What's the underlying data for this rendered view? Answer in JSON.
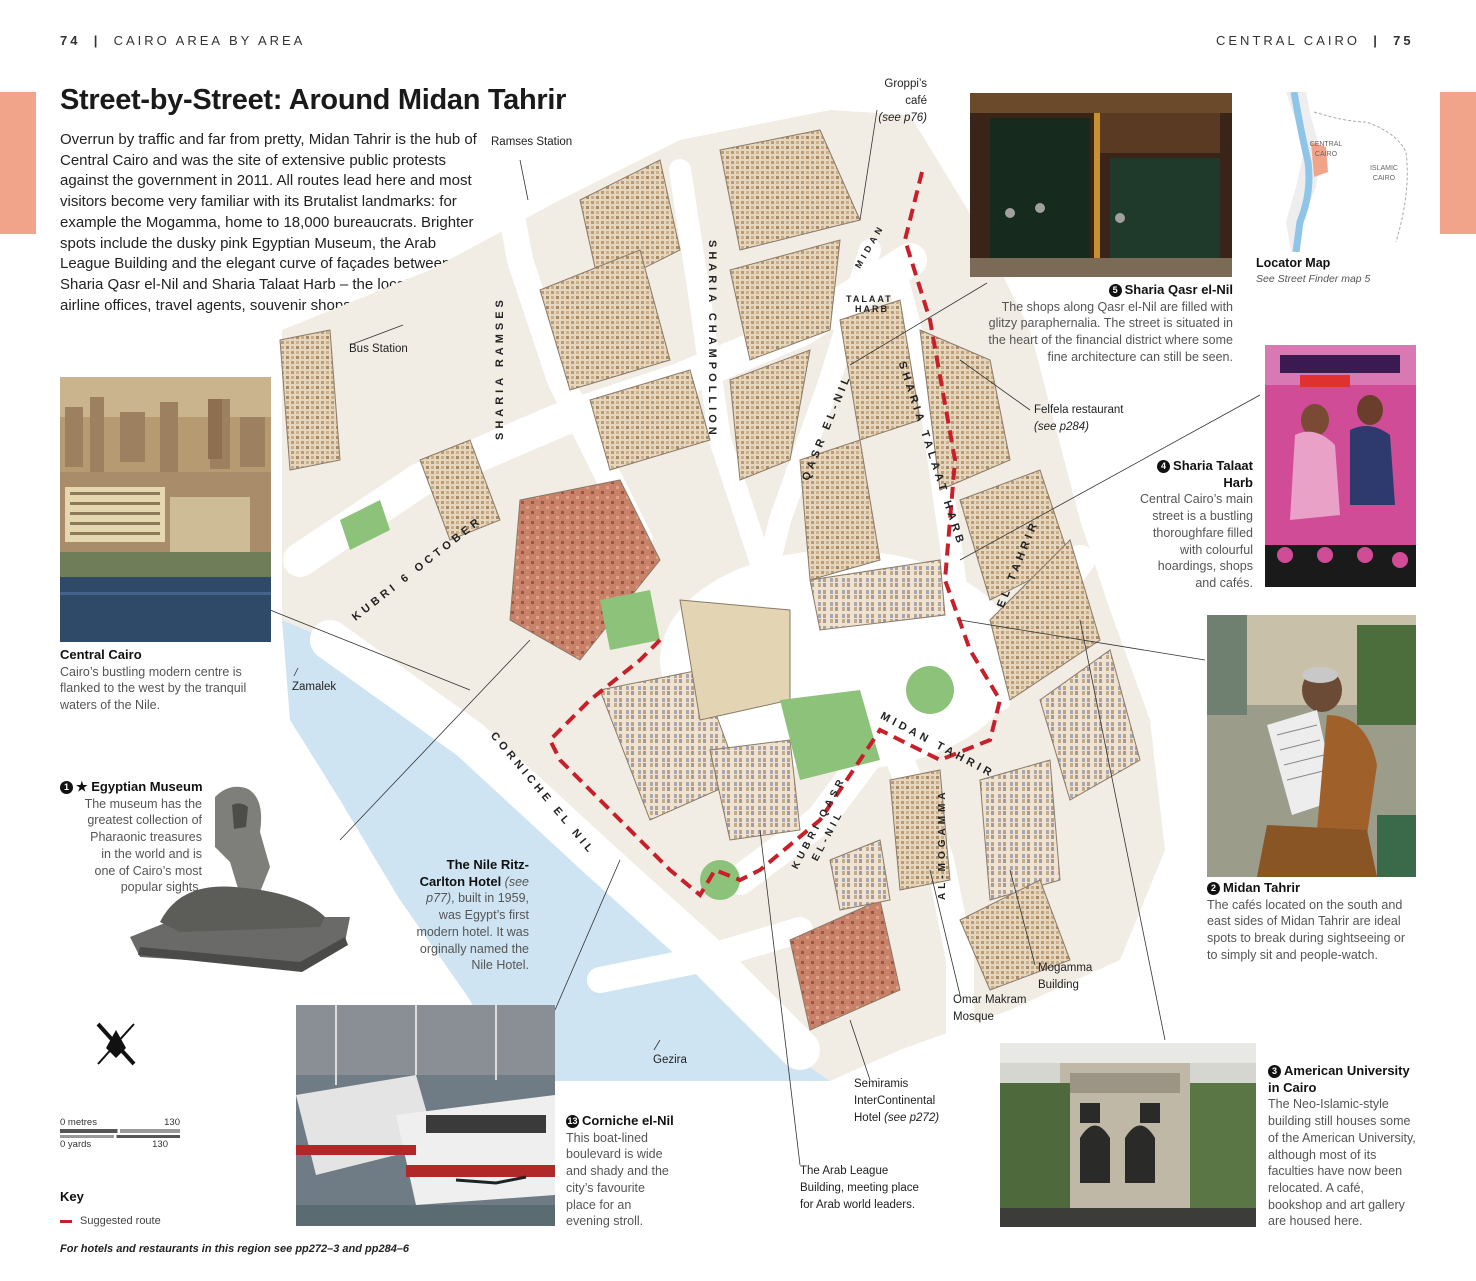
{
  "header": {
    "left_page": "74",
    "left_section": "CAIRO AREA BY AREA",
    "right_section": "CENTRAL CAIRO",
    "right_page": "75",
    "divider": "|"
  },
  "title": "Street-by-Street: Around Midan Tahrir",
  "intro": "Overrun by traffic and far from pretty, Midan Tahrir is the hub of Central Cairo and was the site of extensive public protests against the government in 2011. All routes lead here and most visitors become very familiar with its Brutalist landmarks: for example the Mogamma, home to 18,000 bureaucrats. Brighter spots include the dusky pink Egyptian Museum, the Arab League Building and the elegant curve of façades between Sharia Qasr el-Nil and Sharia Talaat Harb – the location of airline offices, travel agents, souvenir shops and cafés.",
  "captions": {
    "central_cairo": {
      "title": "Central Cairo",
      "text": "Cairo’s bustling modern centre is flanked to the west by the tranquil waters of the Nile."
    },
    "egyptian_museum": {
      "num": "1",
      "title": "★ Egyptian Museum",
      "text": "The museum has the greatest collection of Pharaonic treasures in the world and is one of Cairo’s most popular sights."
    },
    "nile_ritz": {
      "title": "The Nile Ritz-Carlton Hotel",
      "ref": "(see p77)",
      "text": ", built in 1959, was Egypt’s first modern hotel. It was orginally named the Nile Hotel."
    },
    "corniche": {
      "num": "13",
      "title": "Corniche el-Nil",
      "text": "This boat-lined boulevard is wide and shady and the city’s favourite place for an evening stroll."
    },
    "qasr_el_nil": {
      "num": "5",
      "title": "Sharia Qasr el-Nil",
      "text": "The shops along Qasr el-Nil are filled with glitzy paraphernalia. The street is situated in the heart of the financial district where some fine architecture can still be seen."
    },
    "talaat_harb": {
      "num": "4",
      "title": "Sharia Talaat Harb",
      "text": "Central Cairo’s main street is a bustling thoroughfare filled with colourful hoardings, shops and cafés."
    },
    "midan_tahrir": {
      "num": "2",
      "title": "Midan Tahrir",
      "text": "The cafés located on the south and east sides of Midan Tahrir are ideal spots to break during sightseeing or to simply sit and people-watch."
    },
    "auc": {
      "num": "3",
      "title": "American University in Cairo",
      "text": "The Neo-Islamic-style building still houses some of the American University, although most of its faculties have now been relocated. A café, bookshop and art gallery are housed here."
    }
  },
  "locator": {
    "title": "Locator Map",
    "sub": "See Street Finder map 5",
    "area1": "CENTRAL CAIRO",
    "area2": "ISLAMIC CAIRO"
  },
  "map_labels": {
    "groppi": "Groppi’s café",
    "groppi_ref": "(see p76)",
    "ramses_station": "Ramses Station",
    "bus_station": "Bus Station",
    "felfela": "Felfela restaurant",
    "felfela_ref": "(see p284)",
    "zamalek": "Zamalek",
    "gezira": "Gezira",
    "mogamma_building": "Mogamma Building",
    "omar_makram": "Omar Makram Mosque",
    "semiramis": "Semiramis InterContinental Hotel",
    "semiramis_ref": "(see p272)",
    "arab_league": "The Arab League Building, meeting place for Arab world leaders."
  },
  "streets": {
    "ramses": "SHARIA RAMSES",
    "champollion": "SHARIA CHAMPOLLION",
    "kubri6": "KUBRI 6 OCTOBER",
    "qasr": "QASR EL-NIL",
    "midan_talaat": "MIDAN",
    "midan_talaat2": "TALAAT",
    "midan_talaat3": "HARB",
    "talaat_harb": "SHARIA TALAAT HARB",
    "eltahrir": "EL TAHRIR",
    "midan_tahrir": "MIDAN TAHRIR",
    "corniche": "CORNICHE EL NIL",
    "kubri_qasr": "KUBRI QASR",
    "kubri_qasr2": "EL-NIL",
    "mogamma": "AL-MOGAMMA"
  },
  "scale": {
    "metres": "0 metres",
    "metres_val": "130",
    "yards": "0 yards",
    "yards_val": "130"
  },
  "key": {
    "title": "Key",
    "route": "Suggested route"
  },
  "footer": "For hotels and restaurants in this region see pp272–3 and pp284–6",
  "colors": {
    "tab": "#f2a48a",
    "route": "#c8202a",
    "nile": "#cfe4f2",
    "building": "#e9dcc8"
  }
}
